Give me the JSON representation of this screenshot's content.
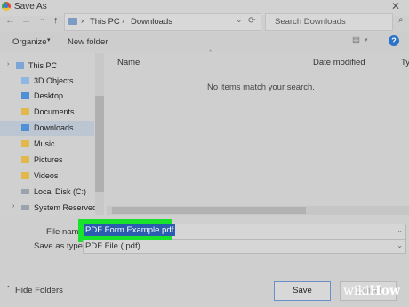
{
  "window": {
    "title": "Save As",
    "close_glyph": "✕"
  },
  "address": {
    "back_glyph": "←",
    "forward_glyph": "→",
    "recent_glyph": "⌄",
    "up_glyph": "↑",
    "sep": "›",
    "crumbs": [
      "This PC",
      "Downloads"
    ],
    "dropdown_glyph": "⌄",
    "refresh_glyph": "⟳"
  },
  "search": {
    "placeholder": "Search Downloads",
    "icon": "search-icon"
  },
  "toolbar": {
    "organize": "Organize",
    "organize_chev": "▾",
    "new_folder": "New folder",
    "view_glyph": "▤",
    "view_chev": "▾",
    "help": "?"
  },
  "nav": {
    "items": [
      {
        "label": "This PC",
        "icon": "pc-icon"
      },
      {
        "label": "3D Objects",
        "icon": "folder-icon"
      },
      {
        "label": "Desktop",
        "icon": "folder-icon"
      },
      {
        "label": "Documents",
        "icon": "folder-icon"
      },
      {
        "label": "Downloads",
        "icon": "folder-icon",
        "selected": true
      },
      {
        "label": "Music",
        "icon": "folder-icon"
      },
      {
        "label": "Pictures",
        "icon": "folder-icon"
      },
      {
        "label": "Videos",
        "icon": "folder-icon"
      },
      {
        "label": "Local Disk (C:)",
        "icon": "drive-icon"
      },
      {
        "label": "System Reserved",
        "icon": "drive-icon"
      }
    ]
  },
  "filelist": {
    "columns": [
      "Name",
      "Date modified",
      "Ty"
    ],
    "sort_glyph": "^",
    "empty_message": "No items match your search."
  },
  "form": {
    "filename_label": "File name:",
    "filename_value": "PDF Form Example.pdf",
    "saveas_label": "Save as type:",
    "saveas_value": "PDF File (.pdf)",
    "chev": "⌄"
  },
  "footer": {
    "hide_folders": "Hide Folders",
    "hide_glyph": "⌃",
    "save": "Save",
    "cancel": "Cancel"
  },
  "watermark": {
    "wiki": "wiki",
    "how": "How"
  },
  "colors": {
    "highlight": "#19e22c",
    "selection": "#2a5db0",
    "help": "#2a73c8"
  }
}
